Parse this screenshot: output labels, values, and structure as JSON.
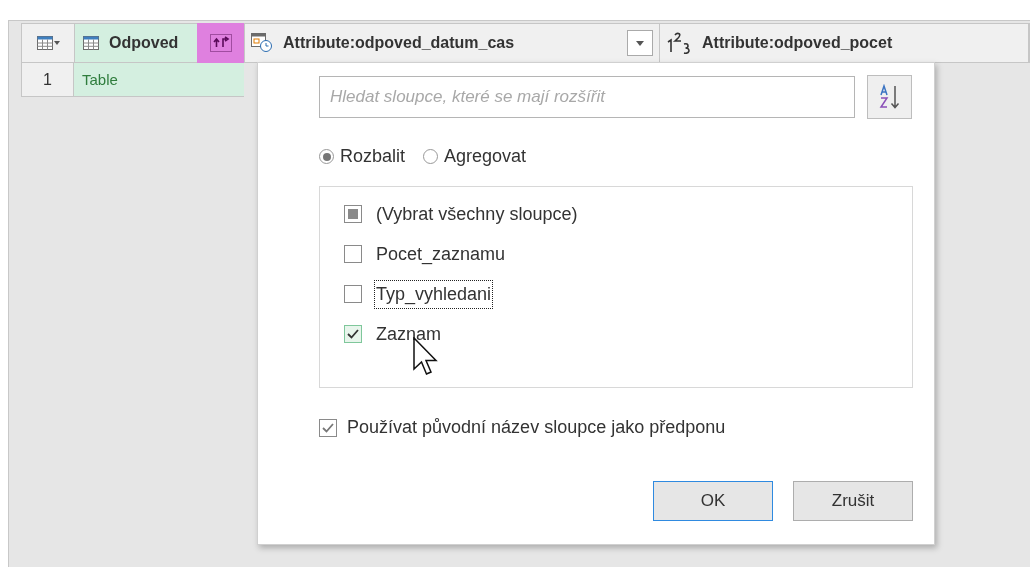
{
  "table": {
    "columns": [
      {
        "label": "Odpoved",
        "kind": "table"
      },
      {
        "label": "Attribute:odpoved_datum_cas",
        "kind": "datetime"
      },
      {
        "label": "Attribute:odpoved_pocet",
        "kind": "number"
      }
    ],
    "rows": [
      {
        "number": "1",
        "cells": [
          "Table"
        ]
      }
    ]
  },
  "expand_popup": {
    "search": {
      "placeholder": "Hledat sloupce, které se mají rozšířit"
    },
    "modes": [
      {
        "label": "Rozbalit",
        "selected": true
      },
      {
        "label": "Agregovat",
        "selected": false
      }
    ],
    "columns": [
      {
        "label": "(Vybrat všechny sloupce)",
        "checked": false,
        "indeterminate": true,
        "focused": false
      },
      {
        "label": "Pocet_zaznamu",
        "checked": false,
        "indeterminate": false,
        "focused": false
      },
      {
        "label": "Typ_vyhledani",
        "checked": false,
        "indeterminate": false,
        "focused": true
      },
      {
        "label": "Zaznam",
        "checked": true,
        "indeterminate": false,
        "focused": false
      }
    ],
    "prefix_option": {
      "label": "Používat původní název sloupce jako předponu",
      "checked": true
    },
    "buttons": [
      {
        "label": "OK",
        "default": true
      },
      {
        "label": "Zrušit",
        "default": false
      }
    ]
  }
}
